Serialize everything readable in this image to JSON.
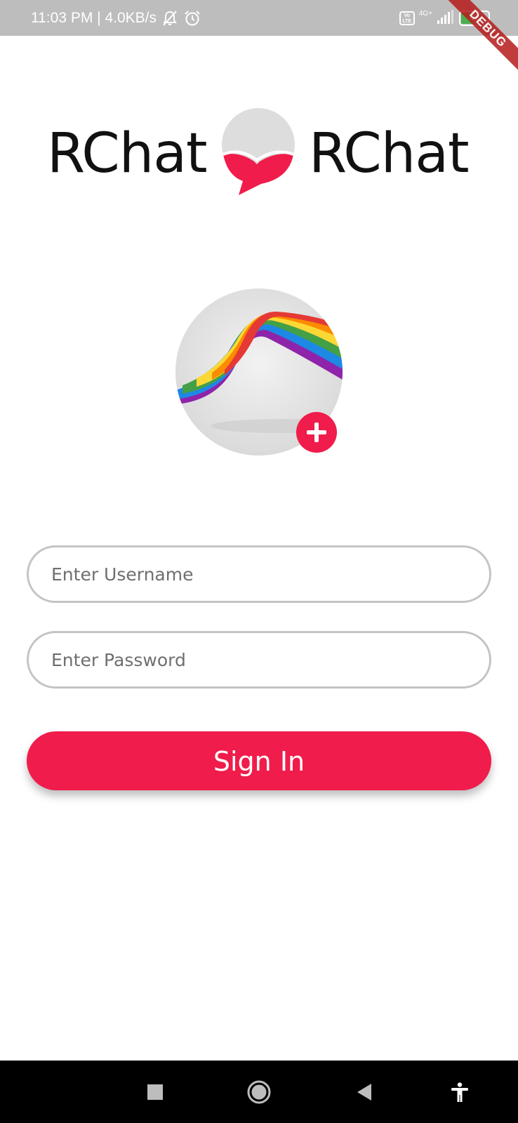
{
  "status_bar": {
    "time_speed": "11:03 PM | 4.0KB/s",
    "icons": [
      "mute-bell-icon",
      "alarm-icon",
      "volte-icon",
      "signal-icon",
      "battery-icon"
    ],
    "volte_label": "Vo LTE",
    "network_label": "4G+",
    "battery_level": "44",
    "battery_fraction": 0.44
  },
  "debug_banner": "DEBUG",
  "logo": {
    "left_text": "RChat",
    "right_text": "RChat",
    "colors": {
      "grey": "#dddddd",
      "red": "#f01c4b"
    }
  },
  "avatar": {
    "icon": "add-photo-icon",
    "button_color": "#f01c4b"
  },
  "form": {
    "username_placeholder": "Enter Username",
    "username_value": "",
    "password_placeholder": "Enter Password",
    "password_value": "",
    "sign_in_label": "Sign In",
    "accent_color": "#f01c4b"
  },
  "nav_bar": {
    "buttons": [
      "recents-square-icon",
      "home-circle-icon",
      "back-triangle-icon",
      "accessibility-icon"
    ]
  }
}
